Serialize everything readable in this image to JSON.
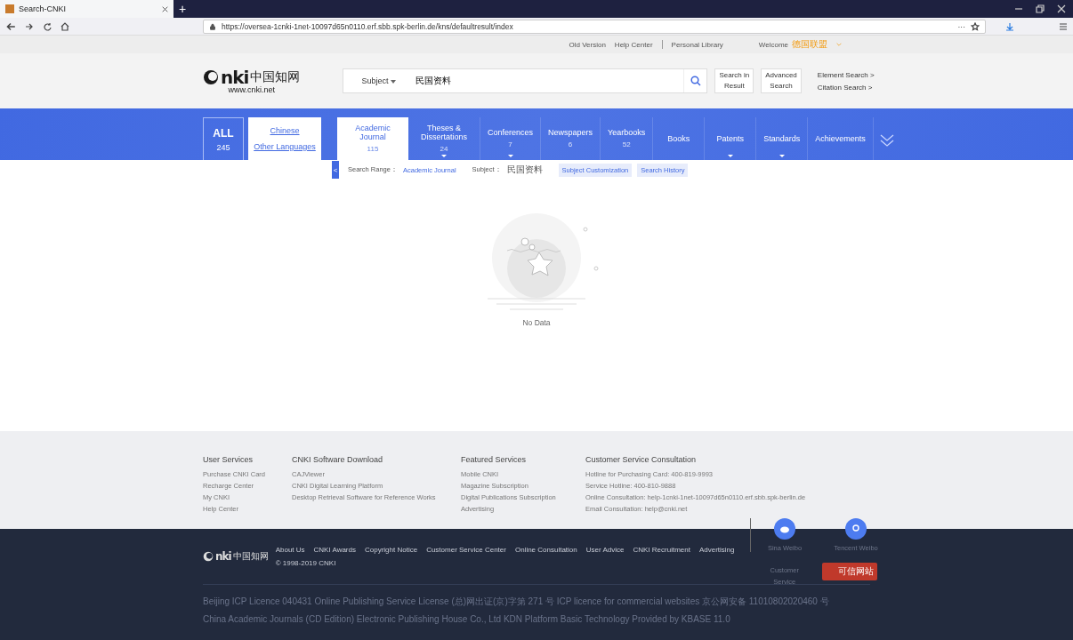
{
  "browser": {
    "tab_title": "Search-CNKI",
    "new_tab": "+",
    "url": "https://oversea-1cnki-1net-10097d65n0110.erf.sbb.spk-berlin.de/kns/defaultresult/index",
    "page_actions": "···"
  },
  "logo": {
    "mark": "nki",
    "name": "中国知网",
    "url": "www.cnki.net"
  },
  "footer_logo": {
    "mark": "nki",
    "name": "中国知网"
  },
  "top_links": {
    "items": [
      "Old Version",
      "Help Center",
      "Personal Library"
    ],
    "welcome": "Welcome",
    "user": "德国联盟"
  },
  "search": {
    "field_type": "Subject",
    "query": "民国资料",
    "buttons": [
      [
        "Search in",
        "Result"
      ],
      [
        "Advanced",
        "Search"
      ]
    ],
    "links": [
      "Element Search >",
      "Citation Search >"
    ]
  },
  "nav": {
    "all": {
      "label": "ALL",
      "count": "245",
      "selected": false
    },
    "languages": [
      "Chinese",
      "Other Languages"
    ],
    "tabs": [
      {
        "label": "Academic Journal",
        "count": "115",
        "dropdown": false,
        "selected": true
      },
      {
        "label": "Theses & Dissertations",
        "count": "24",
        "dropdown": true,
        "selected": false
      },
      {
        "label": "Conferences",
        "count": "7",
        "dropdown": true,
        "selected": false
      },
      {
        "label": "Newspapers",
        "count": "6",
        "dropdown": false,
        "selected": false
      },
      {
        "label": "Yearbooks",
        "count": "52",
        "dropdown": false,
        "selected": false
      },
      {
        "label": "Books",
        "dropdown": false,
        "selected": false
      },
      {
        "label": "Patents",
        "dropdown": true,
        "selected": false
      },
      {
        "label": "Standards",
        "dropdown": true,
        "selected": false
      },
      {
        "label": "Achievements",
        "dropdown": false,
        "selected": false
      }
    ]
  },
  "filter_bar": {
    "collapse": "<",
    "range_label": "Search Range：",
    "range_value": "Academic Journal",
    "subject_label": "Subject：",
    "subject_value": "民国资料",
    "buttons": [
      "Subject Customization",
      "Search History"
    ]
  },
  "empty_state": {
    "message": "No Data"
  },
  "footer": {
    "columns": [
      {
        "heading": "User Services",
        "items": [
          "Purchase CNKI Card",
          "Recharge Center",
          "My CNKI",
          "Help Center"
        ]
      },
      {
        "heading": "CNKI Software Download",
        "items": [
          "CAJViewer",
          "CNKI Digital Learning Platform",
          "Desktop Retrieval Software for Reference Works"
        ]
      },
      {
        "heading": "Featured Services",
        "items": [
          "Mobile CNKI",
          "Magazine Subscription",
          "Digital Publications Subscription",
          "Advertising"
        ]
      },
      {
        "heading": "Customer Service Consultation",
        "items": [
          "Hotline for Purchasing Card: 400-819-9993",
          "Service Hotline: 400-810-9888",
          "Online Consultation: help-1cnki-1net-10097d65n0110.erf.sbb.spk-berlin.de",
          "Email Consultation: help@cnki.net"
        ]
      }
    ],
    "social": [
      {
        "label": "Sina Weibo",
        "kind": "weibo"
      },
      {
        "label": "Tencent Weibo",
        "kind": "tencent"
      }
    ],
    "links": [
      "About Us",
      "CNKI Awards",
      "Copyright Notice",
      "Customer Service Center",
      "Online Consultation",
      "User Advice",
      "CNKI Recruitment",
      "Advertising"
    ],
    "copyright": "© 1998-2019 CNKI",
    "customer_service": [
      "Customer",
      "Service"
    ],
    "badge": "可信网站",
    "legal": [
      "Beijing ICP Licence 040431  Online Publishing Service License (总)网出证(京)字第 271 号   ICP licence for commercial websites  京公网安备 11010802020460 号",
      "China Academic Journals (CD Edition) Electronic Publishing House Co., Ltd  KDN Platform Basic Technology Provided by KBASE 11.0"
    ]
  }
}
